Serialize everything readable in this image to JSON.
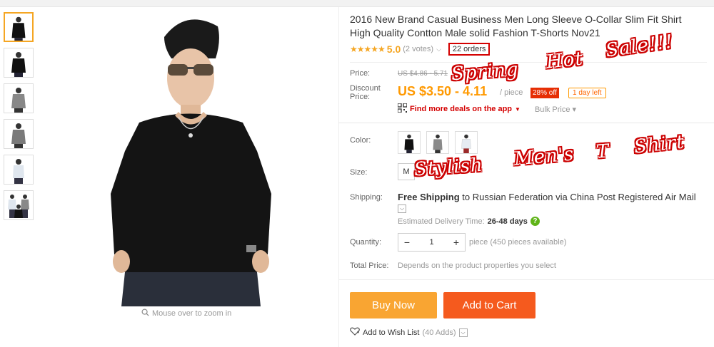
{
  "product": {
    "title": "2016 New Brand Casual Business Men Long Sleeve O-Collar Slim Fit Shirt High Quality Contton Male solid Fashion T-Shorts Nov21",
    "stars": "★★★★★",
    "rating": "5.0",
    "votes": "(2 votes)",
    "orders": "22 orders"
  },
  "gallery": {
    "zoom_hint": "Mouse over to zoom in",
    "thumbnail_count": 6
  },
  "pricing": {
    "price_label": "Price:",
    "old_price": "US $4.86 - 5.71",
    "discount_label_1": "Discount",
    "discount_label_2": "Price:",
    "price": "US $3.50 - 4.11",
    "per": "/ piece",
    "discount_badge": "28% off",
    "time_left": "1 day left",
    "deals_text": "Find more deals on the app",
    "bulk_price": "Bulk Price ▾"
  },
  "options": {
    "color_label": "Color:",
    "size_label": "Size:",
    "size_value": "M",
    "shipping_label": "Shipping:",
    "shipping_bold": "Free Shipping",
    "shipping_to": " to ",
    "shipping_dest": "Russian Federation via China Post Registered Air Mail",
    "delivery_label": "Estimated Delivery Time:",
    "delivery_days": "26-48 days",
    "quantity_label": "Quantity:",
    "quantity_value": "1",
    "quantity_minus": "−",
    "quantity_plus": "+",
    "pieces_available": "piece (450 pieces available)",
    "total_label": "Total Price:",
    "total_value": "Depends on the product properties you select"
  },
  "actions": {
    "buy_now": "Buy Now",
    "add_to_cart": "Add to Cart",
    "wish_list": "Add to Wish List",
    "wish_count": "(40 Adds)"
  },
  "overlay": {
    "spring": "Spring",
    "hot": "Hot",
    "sale": "Sale!!!",
    "stylish": "Stylish",
    "mens": "Men's",
    "t": "T",
    "shirt": "Shirt"
  },
  "colors": {
    "price": "#ff9900",
    "badge": "#e62e04",
    "buy_now": "#f9a532",
    "add_to_cart": "#f55a1e",
    "star": "#f5a623",
    "orders_box": "#d40000"
  }
}
